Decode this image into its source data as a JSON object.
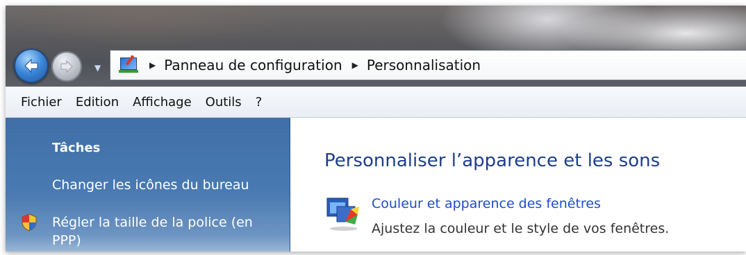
{
  "breadcrumb": {
    "items": [
      "Panneau de configuration",
      "Personnalisation"
    ]
  },
  "menubar": {
    "items": [
      "Fichier",
      "Edition",
      "Affichage",
      "Outils",
      "?"
    ]
  },
  "sidebar": {
    "title": "Tâches",
    "links": [
      "Changer les icônes du bureau",
      "Régler la taille de la police (en",
      "PPP)"
    ]
  },
  "main": {
    "heading": "Personnaliser l’apparence et les sons",
    "item": {
      "link": "Couleur et apparence des fenêtres",
      "description": "Ajustez la couleur et le style de vos fenêtres."
    }
  },
  "icons": {
    "back": "back-arrow-icon",
    "forward": "forward-arrow-icon",
    "control_panel": "control-panel-icon",
    "shield": "uac-shield-icon",
    "window_color": "window-color-icon"
  }
}
